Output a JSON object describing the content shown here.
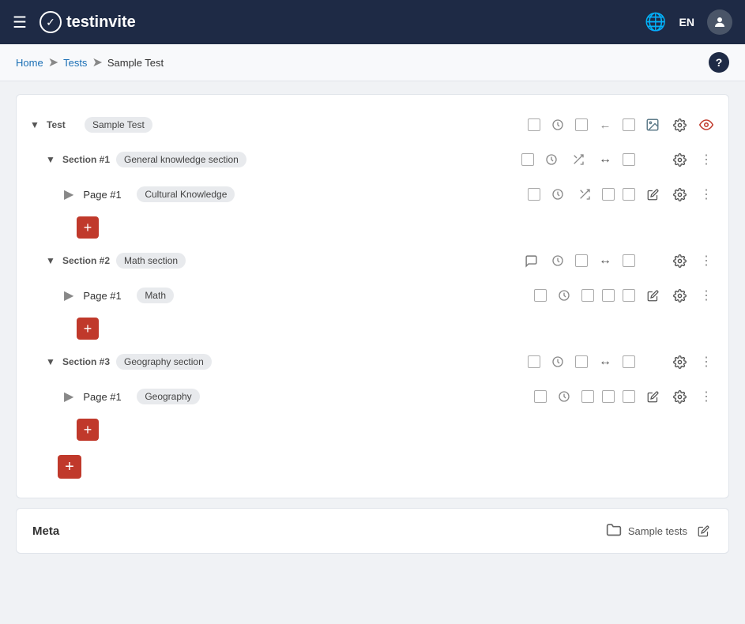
{
  "header": {
    "hamburger_icon": "☰",
    "logo_check": "✓",
    "logo_text_normal": "test",
    "logo_text_bold": "invite",
    "globe_icon": "🌐",
    "lang": "EN",
    "user_icon": "👤"
  },
  "breadcrumb": {
    "home": "Home",
    "tests": "Tests",
    "current": "Sample Test",
    "help": "?"
  },
  "tree": {
    "test_label": "Test",
    "test_name": "Sample Test",
    "sections": [
      {
        "id": "section-1",
        "label": "Section #1",
        "badge": "General knowledge section",
        "pages": [
          {
            "id": "page-1-1",
            "label": "Page #1",
            "badge": "Cultural Knowledge"
          }
        ]
      },
      {
        "id": "section-2",
        "label": "Section #2",
        "badge": "Math section",
        "pages": [
          {
            "id": "page-2-1",
            "label": "Page #1",
            "badge": "Math"
          }
        ]
      },
      {
        "id": "section-3",
        "label": "Section #3",
        "badge": "Geography section",
        "pages": [
          {
            "id": "page-3-1",
            "label": "Page #1",
            "badge": "Geography"
          }
        ]
      }
    ]
  },
  "meta": {
    "title": "Meta",
    "folder_icon": "📁",
    "folder_label": "Sample tests",
    "edit_icon": "✏️"
  },
  "icons": {
    "expand": "▼",
    "collapse": "▶",
    "page_marker": "▶",
    "clock": "🕐",
    "shuffle": "⇌",
    "arrows": "↔",
    "settings": "⚙",
    "edit": "✏",
    "more": "⋮",
    "chat": "💬",
    "image": "🖼",
    "eye_red": "👁",
    "back": "←",
    "add": "+"
  }
}
